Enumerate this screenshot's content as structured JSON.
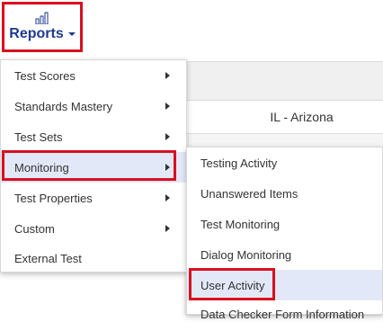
{
  "toolbar": {
    "reports_label": "Reports",
    "reports_icon": "bar-chart-icon"
  },
  "background": {
    "cell_value": "IL - Arizona"
  },
  "reports_menu": {
    "items": [
      {
        "label": "Test Scores",
        "has_submenu": true
      },
      {
        "label": "Standards Mastery",
        "has_submenu": true
      },
      {
        "label": "Test Sets",
        "has_submenu": true
      },
      {
        "label": "Monitoring",
        "has_submenu": true
      },
      {
        "label": "Test Properties",
        "has_submenu": true
      },
      {
        "label": "Custom",
        "has_submenu": true
      },
      {
        "label": "External Test",
        "has_submenu": false
      }
    ]
  },
  "monitoring_submenu": {
    "items": [
      {
        "label": "Testing Activity"
      },
      {
        "label": "Unanswered Items"
      },
      {
        "label": "Test Monitoring"
      },
      {
        "label": "Dialog Monitoring"
      },
      {
        "label": "User Activity"
      },
      {
        "label": "Data Checker Form Information"
      }
    ]
  },
  "colors": {
    "highlight_border": "#d9101e",
    "brand_text": "#1d3a8f",
    "active_item_bg": "#e3e8f8"
  }
}
